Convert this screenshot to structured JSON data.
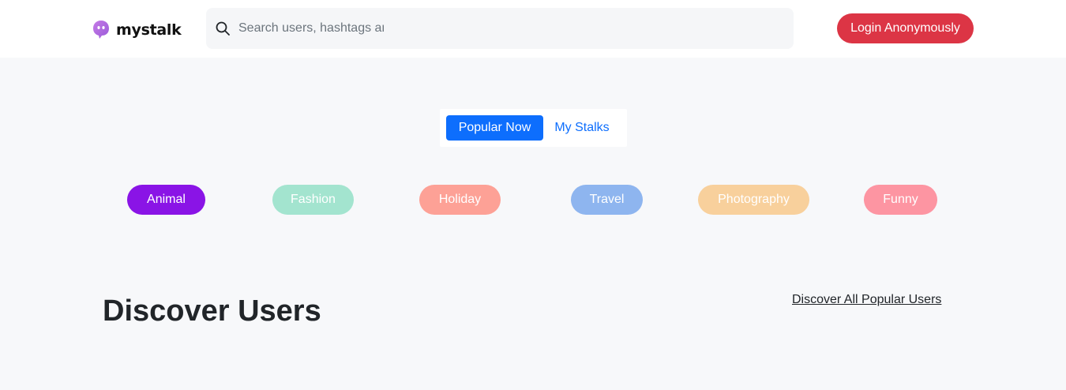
{
  "header": {
    "logo_text": "mystalk",
    "search_placeholder": "Search users, hashtags anc",
    "login_label": "Login Anonymously"
  },
  "tabs": [
    {
      "label": "Popular Now",
      "active": true
    },
    {
      "label": "My Stalks",
      "active": false
    }
  ],
  "categories": [
    {
      "label": "Animal",
      "color": "#8a14e6"
    },
    {
      "label": "Fashion",
      "color": "#a3e4cf"
    },
    {
      "label": "Holiday",
      "color": "#fda196"
    },
    {
      "label": "Travel",
      "color": "#8eb5ef"
    },
    {
      "label": "Photography",
      "color": "#f8d09c"
    },
    {
      "label": "Funny",
      "color": "#fd95a2"
    }
  ],
  "discover": {
    "title": "Discover Users",
    "link": "Discover All Popular Users"
  },
  "colors": {
    "accent": "#0d6efd",
    "login": "#dc3545",
    "logo": "#b56de0"
  },
  "icons": {
    "logo": "ghost-chat-bubble-icon",
    "search": "search-icon"
  }
}
